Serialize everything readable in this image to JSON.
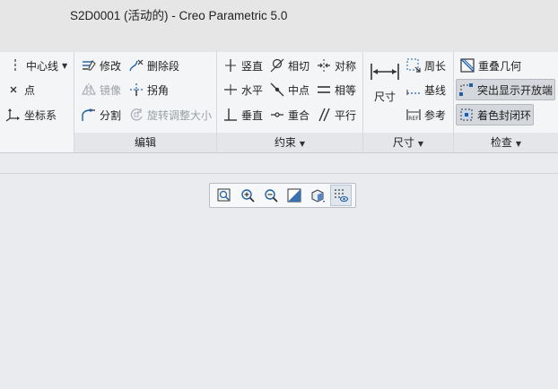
{
  "window": {
    "title": "S2D0001 (活动的) - Creo Parametric 5.0"
  },
  "ribbon": {
    "sketch": {
      "centerline_label": "中心线",
      "point_label": "点",
      "coordsys_label": "坐标系"
    },
    "edit": {
      "footer": "编辑",
      "modify_label": "修改",
      "delete_segment_label": "删除段",
      "mirror_label": "镜像",
      "corner_label": "拐角",
      "divide_label": "分割",
      "rotate_resize_label": "旋转调整大小"
    },
    "constrain": {
      "footer": "约束",
      "vertical_label": "竖直",
      "tangent_label": "相切",
      "symmetric_label": "对称",
      "horizontal_label": "水平",
      "midpoint_label": "中点",
      "equal_label": "相等",
      "perpendicular_label": "垂直",
      "coincident_label": "重合",
      "parallel_label": "平行"
    },
    "dimension": {
      "footer": "尺寸",
      "dimension_label": "尺寸",
      "perimeter_label": "周长",
      "baseline_label": "基线",
      "reference_label": "参考"
    },
    "inspect": {
      "footer": "检查",
      "overlap_label": "重叠几何",
      "highlight_open_label": "突出显示开放端",
      "shade_closed_label": "着色封闭环"
    }
  },
  "colors": {
    "accent_blue": "#1f5fa8",
    "icon_dark": "#333333"
  }
}
